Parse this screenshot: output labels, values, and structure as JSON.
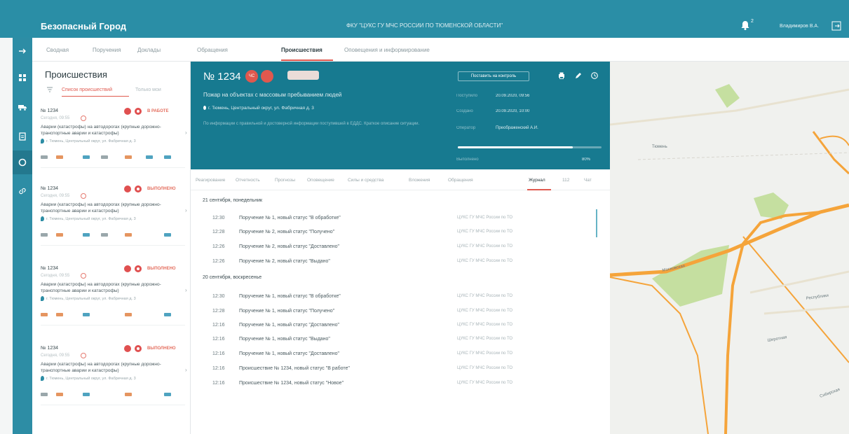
{
  "app": {
    "title": "Безопасный Город",
    "org": "ФКУ \"ЦУКС ГУ МЧС РОССИИ ПО ТЮМЕНСКОЙ ОБЛАСТИ\"",
    "notifications": "2",
    "user": "Владимиров В.А."
  },
  "tabs": [
    {
      "label": "Сводная"
    },
    {
      "label": "Поручения"
    },
    {
      "label": "Доклады"
    },
    {
      "label": "Обращения"
    },
    {
      "label": "Происшествия"
    },
    {
      "label": "Оповещения и информирование"
    }
  ],
  "list": {
    "title": "Происшествия",
    "tab_list": "Список происшествий",
    "tab_map": "Только мои",
    "cards": [
      {
        "num": "№ 1234",
        "sub": "Сегодня, 09:55",
        "status": "В РАБОТЕ",
        "desc": "Аварии (катастрофы) на автодорогах (крупные дорожно-транспортные аварии и катастрофы)",
        "addr": "г. Тюмень, Центральный округ, ул. Фабричная д. 3"
      },
      {
        "num": "№ 1234",
        "sub": "Сегодня, 09:55",
        "status": "ВЫПОЛНЕНО",
        "desc": "Аварии (катастрофы) на автодорогах (крупные дорожно-транспортные аварии и катастрофы)",
        "addr": "г. Тюмень, Центральный округ, ул. Фабричная д. 3"
      },
      {
        "num": "№ 1234",
        "sub": "Сегодня, 09:55",
        "status": "ВЫПОЛНЕНО",
        "desc": "Аварии (катастрофы) на автодорогах (крупные дорожно-транспортные аварии и катастрофы)",
        "addr": "г. Тюмень, Центральный округ, ул. Фабричная д. 3"
      },
      {
        "num": "№ 1234",
        "sub": "Сегодня, 09:55",
        "status": "ВЫПОЛНЕНО",
        "desc": "Аварии (катастрофы) на автодорогах (крупные дорожно-транспортные аварии и катастрофы)",
        "addr": "г. Тюмень, Центральный округ, ул. Фабричная д. 3"
      }
    ]
  },
  "incident": {
    "num": "№ 1234",
    "badge": "ЧС",
    "control_label": "Поставить на контроль",
    "title": "Пожар на объектах с массовым пребыванием людей",
    "addr": "г. Тюмень, Центральный округ, ул. Фабричная д. 3",
    "note": "По информации с правильной и достоверной информации поступившей в ЕДДС. Краткое описание ситуации.",
    "meta": [
      {
        "k": "Поступило",
        "v": "20.09.2020, 09:56"
      },
      {
        "k": "Создано",
        "v": "20.09.2020, 10:00"
      },
      {
        "k": "Оператор",
        "v": "Преображенский А.И."
      }
    ],
    "progress_label": "Выполнено",
    "progress_value": "80%",
    "progress_pct": 80
  },
  "detail_tabs": [
    {
      "label": "Реагирование"
    },
    {
      "label": "Отчетность"
    },
    {
      "label": "Прогнозы"
    },
    {
      "label": "Оповещение"
    },
    {
      "label": "Силы и средства"
    },
    {
      "label": "Вложения"
    },
    {
      "label": "Обращения"
    },
    {
      "label": "Журнал"
    },
    {
      "label": "112"
    },
    {
      "label": "Чат"
    }
  ],
  "journal": {
    "days": [
      {
        "title": "21 сентября, понедельник",
        "rows": [
          {
            "t": "12:30",
            "m": "Поручение № 1, новый статус \"В обработке\"",
            "s": "ЦУКС ГУ МЧС России по ТО"
          },
          {
            "t": "12:28",
            "m": "Поручение № 2, новый статус \"Получено\"",
            "s": "ЦУКС ГУ МЧС России по ТО"
          },
          {
            "t": "12:26",
            "m": "Поручение № 2, новый статус \"Доставлено\"",
            "s": "ЦУКС ГУ МЧС России по ТО"
          },
          {
            "t": "12:26",
            "m": "Поручение № 2, новый статус \"Выдано\"",
            "s": "ЦУКС ГУ МЧС России по ТО"
          }
        ]
      },
      {
        "title": "20 сентября, воскресенье",
        "rows": [
          {
            "t": "12:30",
            "m": "Поручение № 1, новый статус \"В обработке\"",
            "s": "ЦУКС ГУ МЧС России по ТО"
          },
          {
            "t": "12:28",
            "m": "Поручение № 1, новый статус \"Получено\"",
            "s": "ЦУКС ГУ МЧС России по ТО"
          },
          {
            "t": "12:16",
            "m": "Поручение № 1, новый статус \"Доставлено\"",
            "s": "ЦУКС ГУ МЧС России по ТО"
          },
          {
            "t": "12:16",
            "m": "Поручение № 1, новый статус \"Выдано\"",
            "s": "ЦУКС ГУ МЧС России по ТО"
          },
          {
            "t": "12:16",
            "m": "Поручение № 1, новый статус \"Доставлено\"",
            "s": "ЦУКС ГУ МЧС России по ТО"
          },
          {
            "t": "12:16",
            "m": "Происшествие № 1234, новый статус \"В работе\"",
            "s": "ЦУКС ГУ МЧС России по ТО"
          },
          {
            "t": "12:16",
            "m": "Происшествие № 1234, новый статус \"Новое\"",
            "s": "ЦУКС ГУ МЧС России по ТО"
          }
        ]
      }
    ]
  },
  "map": {
    "labels": [
      "Тюмень",
      "Московская",
      "Республики",
      "Широтная",
      "Сибирская"
    ]
  },
  "colors": {
    "header": "#2a8ea6",
    "panel": "#177a90",
    "accent": "#e05a50",
    "road": "#f5a43a",
    "park": "#c5dfa0"
  }
}
